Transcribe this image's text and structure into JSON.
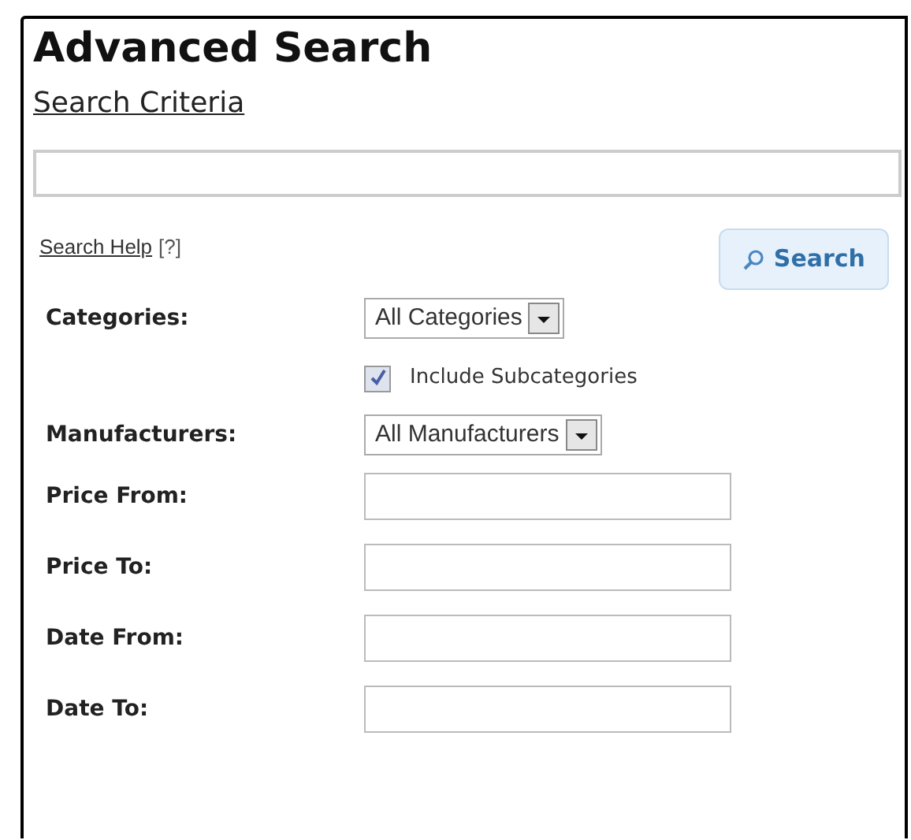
{
  "title": "Advanced Search",
  "subtitle": "Search Criteria",
  "help": {
    "link": "Search Help",
    "mark": "[?]"
  },
  "search_button": "Search",
  "fields": [
    {
      "kind": "select",
      "label": "Categories:",
      "value": "All Categories"
    },
    {
      "kind": "checkbox",
      "label": "Include Subcategories",
      "checked": true
    },
    {
      "kind": "select",
      "label": "Manufacturers:",
      "value": "All Manufacturers"
    },
    {
      "kind": "text",
      "label": "Price From:"
    },
    {
      "kind": "text",
      "label": "Price To:"
    },
    {
      "kind": "text",
      "label": "Date From:"
    },
    {
      "kind": "text",
      "label": "Date To:"
    }
  ]
}
